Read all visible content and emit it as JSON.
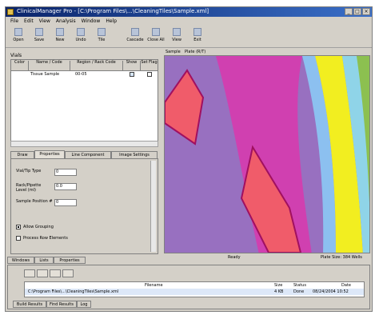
{
  "window": {
    "title": "ClinicalManager Pro - [C:\\Program Files\\...\\CleaningTiles\\Sample.xml]"
  },
  "menu": [
    "File",
    "Edit",
    "View",
    "Analysis",
    "Window",
    "Help"
  ],
  "toolbar": [
    "Open",
    "Save",
    "New",
    "Undo",
    "Tile",
    "Cascade",
    "Close All",
    "View",
    "Exit"
  ],
  "left_panel": {
    "group_label": "Vials",
    "columns": [
      "Color",
      "Name / Code",
      "Region / Rack Code",
      "Show",
      "Set Flag"
    ],
    "rows": [
      {
        "name": "Tissue Sample",
        "code": "00-05",
        "show": true,
        "flag": false
      }
    ],
    "tabs": [
      "Draw",
      "Properties",
      "Line Component",
      "Image Settings"
    ],
    "active_tab": "Properties",
    "fields": [
      {
        "label": "Vial/Tip Type",
        "value": "0"
      },
      {
        "label": "Rack/Pipette Level (ml)",
        "value": "0.0"
      },
      {
        "label": "Sample Position #",
        "value": "0"
      }
    ],
    "checkboxes": [
      {
        "label": "Allow Grouping",
        "checked": true
      },
      {
        "label": "Process Row Elements",
        "checked": false
      }
    ],
    "bottom_tabs": [
      "Windows",
      "Lists",
      "Properties"
    ]
  },
  "view": {
    "tabs": [
      "Sample",
      "Plate (R/T)"
    ]
  },
  "status": {
    "left": "Ready",
    "right": "Plate Size: 384 Wells"
  },
  "output": {
    "header": [
      "Filename",
      "Size",
      "Status",
      "Date"
    ],
    "row": {
      "filename": "C:\\Program Files\\...\\CleaningTiles\\Sample.xml",
      "size": "4 KB",
      "status": "Done",
      "date": "08/24/2004 10:52"
    },
    "tabs": [
      "Build Results",
      "Find Results",
      "Log"
    ]
  },
  "colors": {
    "stripe_purple": "#9870c0",
    "stripe_magenta": "#d040b0",
    "stripe_yellow": "#f2ee20",
    "stripe_green": "#8cc050",
    "background_cyan": "#8fd4e8",
    "patch_salmon": "#f05c6a"
  }
}
